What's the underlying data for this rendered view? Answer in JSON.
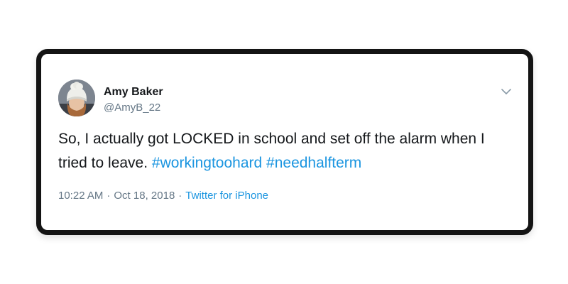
{
  "tweet": {
    "author": {
      "name": "Amy Baker",
      "handle": "@AmyB_22"
    },
    "text": {
      "body": "So, I actually got LOCKED in school and set off the alarm when I tried to leave.",
      "hashtags": [
        "#workingtoohard",
        "#needhalfterm"
      ]
    },
    "meta": {
      "time": "10:22 AM",
      "separator": "·",
      "date": "Oct 18, 2018",
      "source": "Twitter for iPhone"
    },
    "menu_icon": "chevron-down-icon",
    "colors": {
      "link": "#1b95e0",
      "secondary_text": "#657786",
      "primary_text": "#14171a",
      "card_border": "#141414"
    }
  }
}
